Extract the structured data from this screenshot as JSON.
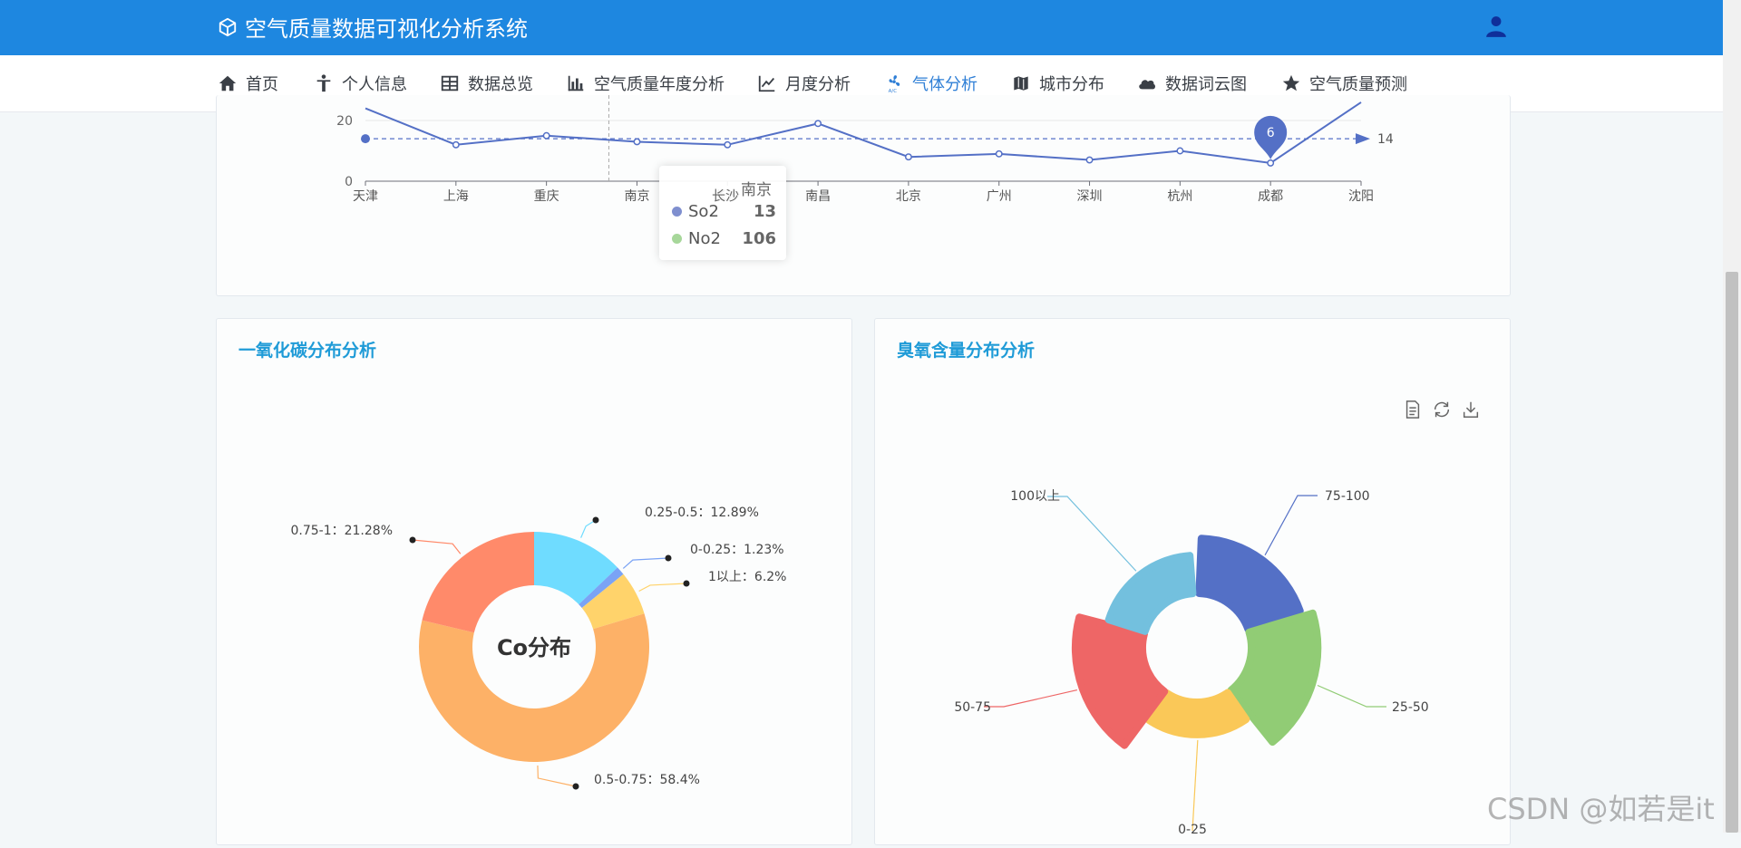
{
  "app": {
    "title": "空气质量数据可视化分析系统"
  },
  "nav": [
    {
      "label": "首页",
      "icon": "home-icon"
    },
    {
      "label": "个人信息",
      "icon": "person-icon"
    },
    {
      "label": "数据总览",
      "icon": "table-icon"
    },
    {
      "label": "空气质量年度分析",
      "icon": "bar-chart-icon"
    },
    {
      "label": "月度分析",
      "icon": "line-chart-icon"
    },
    {
      "label": "气体分析",
      "icon": "fan-icon",
      "active": true
    },
    {
      "label": "城市分布",
      "icon": "map-icon"
    },
    {
      "label": "数据词云图",
      "icon": "cloud-icon"
    },
    {
      "label": "空气质量预测",
      "icon": "star-icon"
    }
  ],
  "line_chart": {
    "chart_data": {
      "type": "line",
      "categories": [
        "天津",
        "上海",
        "重庆",
        "南京",
        "长沙",
        "南昌",
        "北京",
        "广州",
        "深圳",
        "杭州",
        "成都",
        "沈阳"
      ],
      "series": [
        {
          "name": "So2",
          "values": [
            24,
            12,
            15,
            13,
            12,
            19,
            8,
            9,
            7,
            10,
            6,
            26
          ]
        }
      ],
      "ylim": [
        0,
        20
      ],
      "yticks": [
        "0",
        "20"
      ],
      "markline": {
        "value": 14,
        "label": "14"
      },
      "markpoint": {
        "category": "成都",
        "label": "6"
      },
      "color": "#5470c6"
    },
    "tooltip": {
      "title": "南京",
      "axis_label": "长沙",
      "rows": [
        {
          "name": "So2",
          "value": "13",
          "color": "#7f8fcf"
        },
        {
          "name": "No2",
          "value": "106",
          "color": "#a7d79a"
        }
      ]
    }
  },
  "co_card": {
    "title": "一氧化碳分布分析",
    "chart_data": {
      "type": "pie",
      "center_label": "Co分布",
      "slices": [
        {
          "name": "0.25-0.5",
          "percent": 12.89,
          "label": "0.25-0.5：12.89%",
          "color": "#6fdcff"
        },
        {
          "name": "0-0.25",
          "percent": 1.23,
          "label": "0-0.25：1.23%",
          "color": "#7aa3f5"
        },
        {
          "name": "1以上",
          "percent": 6.2,
          "label": "1以上：6.2%",
          "color": "#ffd36b"
        },
        {
          "name": "0.5-0.75",
          "percent": 58.4,
          "label": "0.5-0.75：58.4%",
          "color": "#fdb167"
        },
        {
          "name": "0.75-1",
          "percent": 21.28,
          "label": "0.75-1：21.28%",
          "color": "#ff8a6a"
        }
      ]
    }
  },
  "ozone_card": {
    "title": "臭氧含量分布分析",
    "toolbox": [
      "data-view-icon",
      "restore-icon",
      "save-image-icon"
    ],
    "chart_data": {
      "type": "pie",
      "rose": true,
      "slices": [
        {
          "name": "75-100",
          "label": "75-100",
          "radius": 0.78,
          "color": "#5470c6"
        },
        {
          "name": "25-50",
          "label": "25-50",
          "radius": 0.94,
          "color": "#91cc75"
        },
        {
          "name": "0-25",
          "label": "0-25",
          "radius": 0.46,
          "color": "#fac858"
        },
        {
          "name": "50-75",
          "label": "50-75",
          "radius": 0.95,
          "color": "#ee6666"
        },
        {
          "name": "100以上",
          "label": "100以上",
          "radius": 0.54,
          "color": "#73c0de"
        }
      ]
    }
  },
  "watermark": "CSDN @如若是it"
}
